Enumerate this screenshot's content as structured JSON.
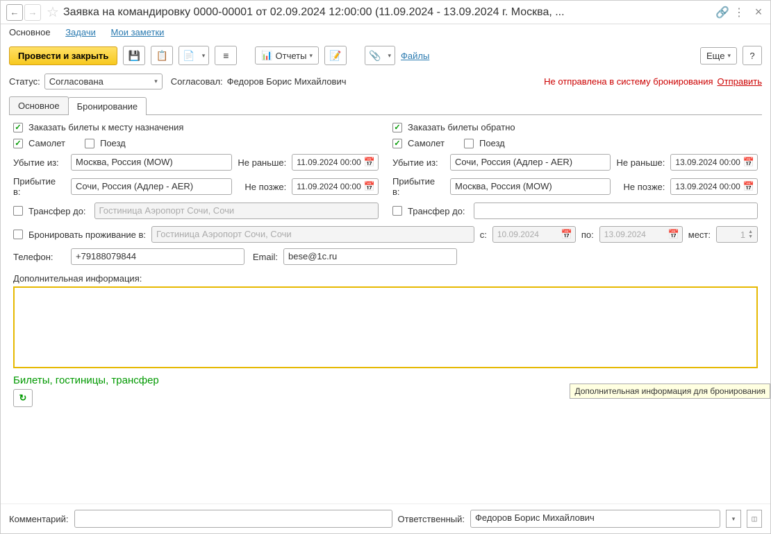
{
  "header": {
    "title": "Заявка на командировку 0000-00001  от 02.09.2024 12:00:00 (11.09.2024 - 13.09.2024 г. Москва, ..."
  },
  "navbar": {
    "main": "Основное",
    "tasks": "Задачи",
    "notes": "Мои заметки"
  },
  "toolbar": {
    "post_close": "Провести и закрыть",
    "reports": "Отчеты",
    "files": "Файлы",
    "more": "Еще"
  },
  "status": {
    "label": "Статус:",
    "value": "Согласована",
    "approved_by_label": "Согласовал:",
    "approved_by": "Федоров Борис Михайлович",
    "not_sent": "Не отправлена в систему бронирования",
    "send": "Отправить"
  },
  "tabs": {
    "main": "Основное",
    "booking": "Бронирование"
  },
  "booking": {
    "out": {
      "order_tickets": "Заказать билеты к месту назначения",
      "plane": "Самолет",
      "train": "Поезд",
      "depart_label": "Убытие из:",
      "depart_val": "Москва, Россия (MOW)",
      "min_label": "Не раньше:",
      "min_val": "11.09.2024 00:00",
      "arrive_label": "Прибытие в:",
      "arrive_val": "Сочи, Россия (Адлер - AER)",
      "max_label": "Не позже:",
      "max_val": "11.09.2024 00:00",
      "transfer_label": "Трансфер до:",
      "transfer_val": "Гостиница Аэропорт Сочи, Сочи"
    },
    "ret": {
      "order_tickets": "Заказать билеты обратно",
      "plane": "Самолет",
      "train": "Поезд",
      "depart_label": "Убытие из:",
      "depart_val": "Сочи, Россия (Адлер - AER)",
      "min_label": "Не раньше:",
      "min_val": "13.09.2024 00:00",
      "arrive_label": "Прибытие в:",
      "arrive_val": "Москва, Россия (MOW)",
      "max_label": "Не позже:",
      "max_val": "13.09.2024 00:00",
      "transfer_label": "Трансфер до:"
    },
    "accom": {
      "label": "Бронировать проживание в:",
      "val": "Гостиница Аэропорт Сочи, Сочи",
      "from_label": "с:",
      "from_val": "10.09.2024",
      "to_label": "по:",
      "to_val": "13.09.2024",
      "places_label": "мест:",
      "places_val": "1"
    },
    "contact": {
      "phone_label": "Телефон:",
      "phone_val": "+79188079844",
      "email_label": "Email:",
      "email_val": "bese@1c.ru"
    },
    "addinfo_label": "Дополнительная информация:",
    "green_header": "Билеты, гостиницы, трансфер"
  },
  "tooltip": "Дополнительная информация для бронирования",
  "footer": {
    "comment_label": "Комментарий:",
    "responsible_label": "Ответственный:",
    "responsible_val": "Федоров Борис Михайлович"
  }
}
